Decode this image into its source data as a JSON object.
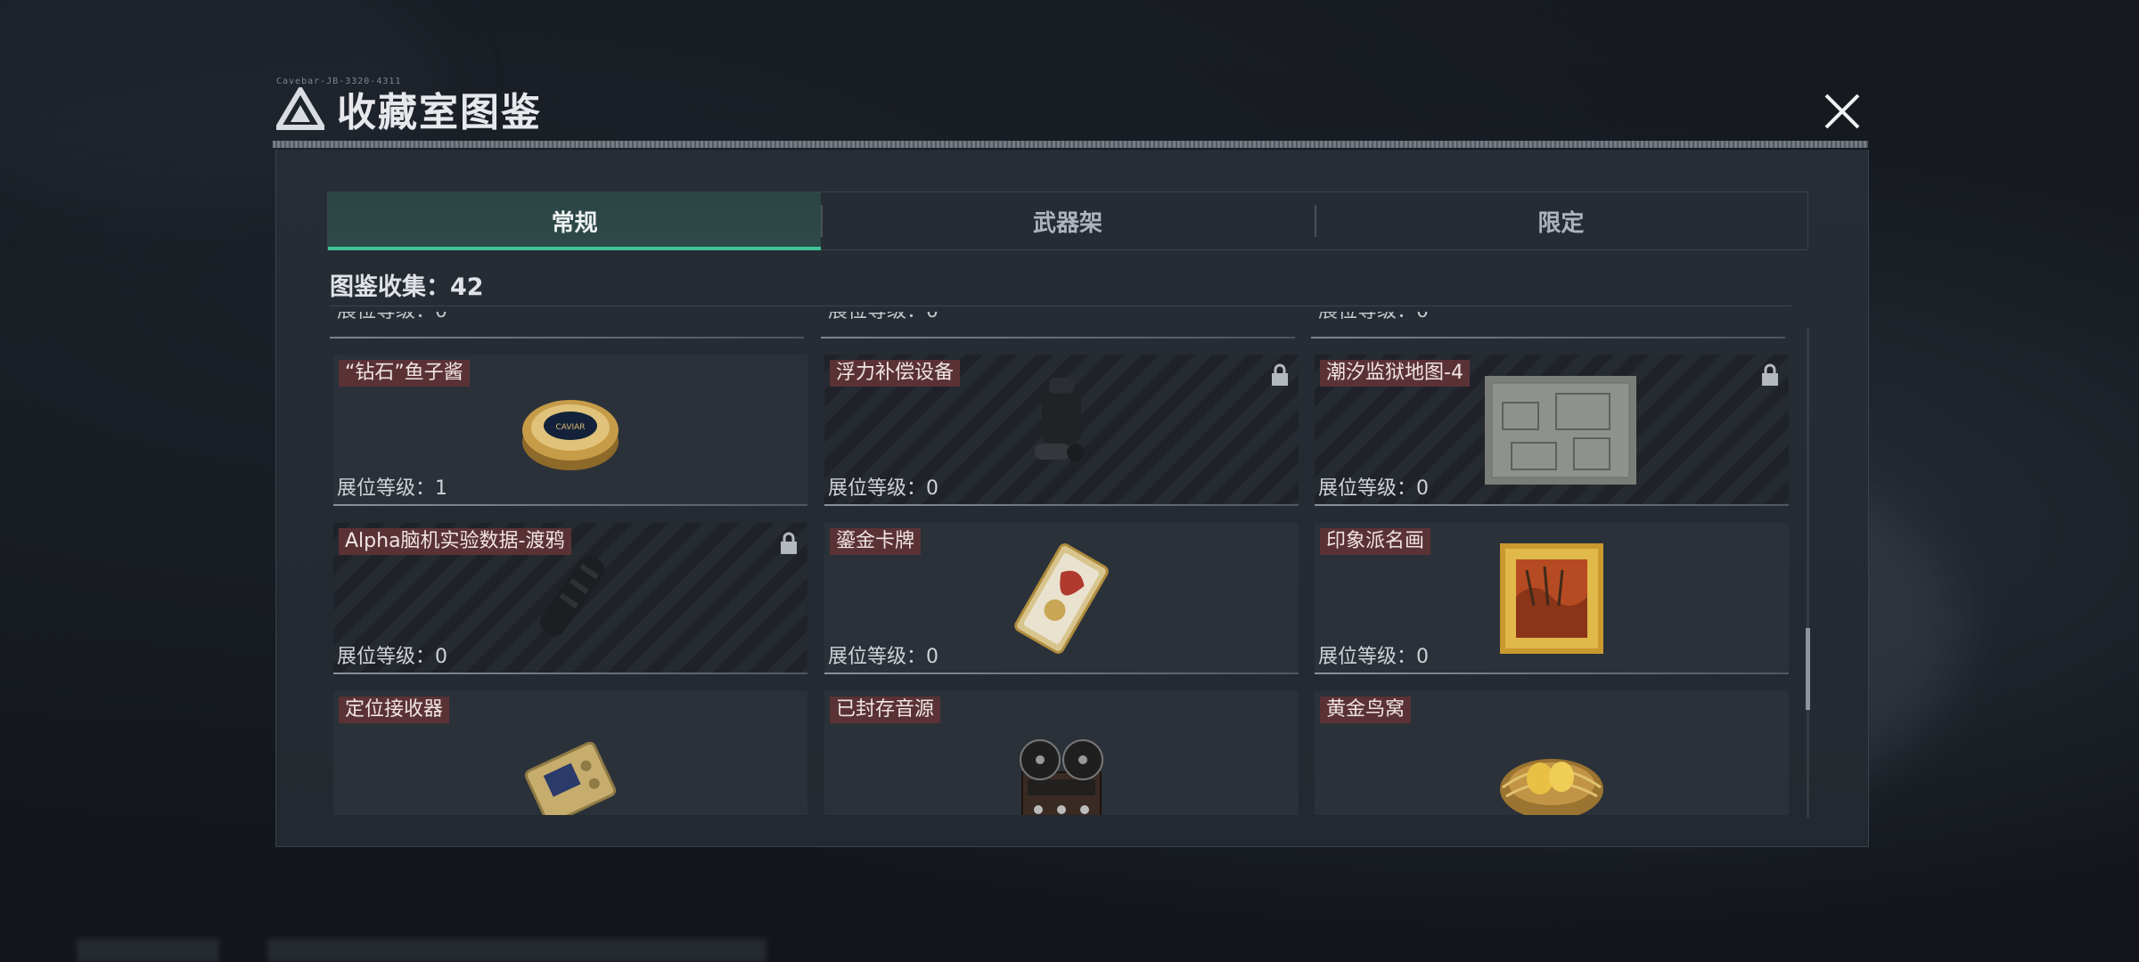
{
  "window": {
    "title": "收藏室图鉴",
    "subtitle_small": "Cavebar-JB-3320-4311"
  },
  "tabs": [
    {
      "label": "常规",
      "active": true
    },
    {
      "label": "武器架",
      "active": false
    },
    {
      "label": "限定",
      "active": false
    }
  ],
  "collection": {
    "label": "图鉴收集：42"
  },
  "partial_row": [
    {
      "text": "展位等级：0"
    },
    {
      "text": "展位等级：0"
    },
    {
      "text": "展位等级：0"
    }
  ],
  "items": [
    {
      "name": "“钻石”鱼子酱",
      "level": "展位等级：1",
      "locked": false,
      "icon": "caviar-tin-icon"
    },
    {
      "name": "浮力补偿设备",
      "level": "展位等级：0",
      "locked": true,
      "icon": "buoyancy-device-icon"
    },
    {
      "name": "潮汐监狱地图-4",
      "level": "展位等级：0",
      "locked": true,
      "icon": "prison-map-icon"
    },
    {
      "name": "Alpha脑机实验数据-渡鸦",
      "level": "展位等级：0",
      "locked": true,
      "icon": "data-device-icon"
    },
    {
      "name": "鎏金卡牌",
      "level": "展位等级：0",
      "locked": false,
      "icon": "gilded-card-icon"
    },
    {
      "name": "印象派名画",
      "level": "展位等级：0",
      "locked": false,
      "icon": "framed-painting-icon"
    },
    {
      "name": "定位接收器",
      "level": "",
      "locked": false,
      "icon": "gps-receiver-icon"
    },
    {
      "name": "已封存音源",
      "level": "",
      "locked": false,
      "icon": "reel-recorder-icon"
    },
    {
      "name": "黄金鸟窝",
      "level": "",
      "locked": false,
      "icon": "golden-nest-icon"
    }
  ],
  "colors": {
    "accent": "#3fc493",
    "name_tag": "#5a3236",
    "panel": "#272d35"
  }
}
